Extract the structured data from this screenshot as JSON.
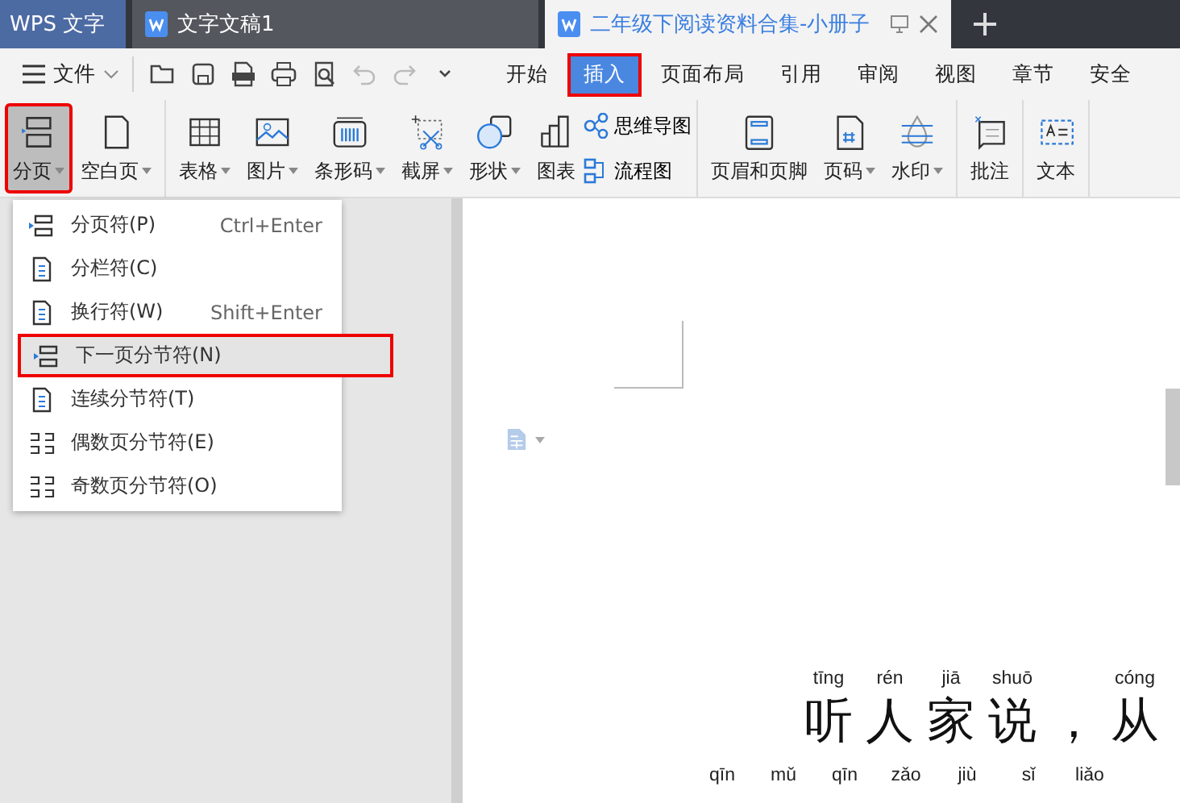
{
  "title_bar": {
    "app_tab": "WPS 文字",
    "tabs": [
      {
        "title": "文字文稿1",
        "selected": false
      },
      {
        "title": "二年级下阅读资料合集-小册子",
        "selected": true
      }
    ]
  },
  "menu_bar": {
    "file_menu": "文件",
    "ribbon_tabs": [
      {
        "label": "开始",
        "selected": false,
        "annotated": false
      },
      {
        "label": "插入",
        "selected": true,
        "annotated": true
      },
      {
        "label": "页面布局",
        "selected": false,
        "annotated": false
      },
      {
        "label": "引用",
        "selected": false,
        "annotated": false
      },
      {
        "label": "审阅",
        "selected": false,
        "annotated": false
      },
      {
        "label": "视图",
        "selected": false,
        "annotated": false
      },
      {
        "label": "章节",
        "selected": false,
        "annotated": false
      },
      {
        "label": "安全",
        "selected": false,
        "annotated": false
      }
    ]
  },
  "ribbon": {
    "groups": [
      [
        {
          "kind": "large",
          "label": "分页",
          "dropdown": true,
          "selected": true,
          "annotated": true
        },
        {
          "kind": "large",
          "label": "空白页",
          "dropdown": true,
          "selected": false,
          "annotated": false
        }
      ],
      [
        {
          "kind": "large",
          "label": "表格",
          "dropdown": true,
          "selected": false,
          "annotated": false
        },
        {
          "kind": "large",
          "label": "图片",
          "dropdown": true,
          "selected": false,
          "annotated": false
        },
        {
          "kind": "large",
          "label": "条形码",
          "dropdown": true,
          "selected": false,
          "annotated": false
        },
        {
          "kind": "large",
          "label": "截屏",
          "dropdown": true,
          "selected": false,
          "annotated": false
        },
        {
          "kind": "large",
          "label": "形状",
          "dropdown": true,
          "selected": false,
          "annotated": false
        },
        {
          "kind": "large",
          "label": "图表",
          "dropdown": false,
          "selected": false,
          "annotated": false
        },
        {
          "kind": "small",
          "label": "思维导图",
          "selected": false
        },
        {
          "kind": "small",
          "label": "流程图",
          "selected": false
        }
      ],
      [
        {
          "kind": "large",
          "label": "页眉和页脚",
          "dropdown": false,
          "selected": false,
          "annotated": false
        },
        {
          "kind": "large",
          "label": "页码",
          "dropdown": true,
          "selected": false,
          "annotated": false
        },
        {
          "kind": "large",
          "label": "水印",
          "dropdown": true,
          "selected": false,
          "annotated": false
        }
      ],
      [
        {
          "kind": "large",
          "label": "批注",
          "dropdown": false,
          "selected": false,
          "annotated": false
        }
      ],
      [
        {
          "kind": "large",
          "label": "文本",
          "dropdown": false,
          "selected": false,
          "annotated": false
        }
      ]
    ]
  },
  "break_menu": {
    "items": [
      {
        "label": "分页符(P)",
        "shortcut": "Ctrl+Enter",
        "selected": false,
        "annotated": false
      },
      {
        "label": "分栏符(C)",
        "selected": false,
        "annotated": false
      },
      {
        "label": "换行符(W)",
        "shortcut": "Shift+Enter",
        "selected": false,
        "annotated": false
      },
      {
        "label": "下一页分节符(N)",
        "selected": true,
        "annotated": true
      },
      {
        "label": "连续分节符(T)",
        "selected": false,
        "annotated": false
      },
      {
        "label": "偶数页分节符(E)",
        "selected": false,
        "annotated": false
      },
      {
        "label": "奇数页分节符(O)",
        "selected": false,
        "annotated": false
      }
    ]
  },
  "document": {
    "lines": [
      {
        "cells": [
          {
            "pinyin": "tīng",
            "char": "听"
          },
          {
            "pinyin": "rén",
            "char": "人"
          },
          {
            "pinyin": "jiā",
            "char": "家"
          },
          {
            "pinyin": "shuō",
            "char": "说"
          },
          {
            "char": "，"
          },
          {
            "pinyin": "cóng",
            "char": "从"
          }
        ]
      },
      {
        "cells": [
          {
            "pinyin": "qīn"
          },
          {
            "pinyin": "mǔ"
          },
          {
            "pinyin": "qīn"
          },
          {
            "pinyin": "zǎo"
          },
          {
            "pinyin": "jiù"
          },
          {
            "pinyin": "sǐ"
          },
          {
            "pinyin": "liǎo"
          }
        ]
      }
    ]
  }
}
